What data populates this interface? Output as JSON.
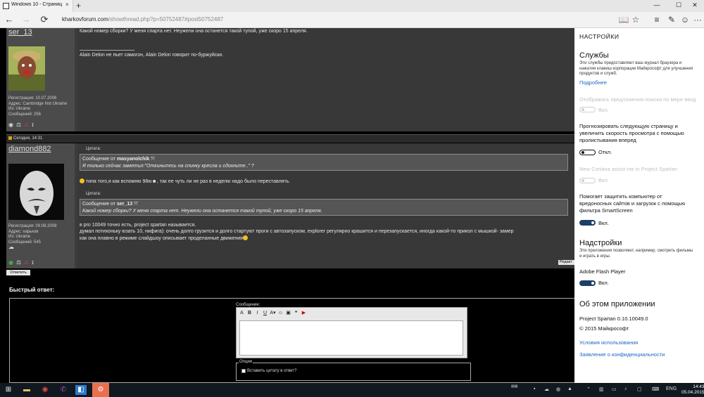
{
  "tabbar": {
    "tab_title": "Windows 10 - Страница...",
    "tab_close": "×",
    "new_tab": "+",
    "minimize": "—",
    "maximize": "☐",
    "close": "✕"
  },
  "navbar": {
    "back": "←",
    "forward": "→",
    "refresh": "⟳",
    "url_domain": "kharkovforum.com",
    "url_path": "/showthread.php?p=50752487#post50752487"
  },
  "tools": {
    "reading_view": "📖",
    "favorite": "☆",
    "hub": "≡",
    "notes": "✎",
    "feedback": "☺",
    "more": "···"
  },
  "posts": [
    {
      "username": "ser_13",
      "info": [
        "Регистрация: 10.07.2006",
        "Адрес: Cambridge Not Ukraine",
        "Из: Ukraine",
        "Сообщений: 256"
      ],
      "body": "Какой номер сборки? У меня спарта нет. Неужели она останется такой тупой, уже скоро 15 апреля.",
      "signature": "Alain Delon не пьет самогон, Alain Delon говорит по-буржуйски."
    },
    {
      "date": "Сегодня, 14:31",
      "username": "diamond882",
      "info": [
        "Регистрация: 09.08.2008",
        "Адрес: харьков",
        "Из: Ukraine",
        "Сообщений: 545"
      ],
      "quote_label": "Цитата:",
      "quote1_prefix": "Сообщение от",
      "quote1_author": "masyanolchik",
      "quote1_text": "Я только сейчас заметил:\"Откиньтесь на спинку кресла и сдохните..\" ?",
      "line1": "типа того,я как вспомню 98ю",
      "line1_tail": ", так ее чуть ли не раз в неделю надо было переставлять.",
      "quote2_prefix": "Сообщение от",
      "quote2_author": "ser_13",
      "quote2_text": "Какой номер сборки? У меня спарта нет. Неужели она останется такой тупой, уже скоро 15 апреля.",
      "line2": "в pro 10049 точно есть, project spartan называется.",
      "line3": "думал потихоньку юзать 10, нифига): очень долго грузится и долго стартуют проги с автозапуском, explorer регулярно крашится и перезапускается, иногда какой-то прикол с мышкой- замер",
      "line4": "как она плавно в режиме слайдшоу описывает проделанные движения"
    }
  ],
  "reply_button": "Ответить",
  "edit_button": "Редакт",
  "quick_reply": {
    "title": "Быстрый ответ:",
    "message_label": "Сообщение:",
    "options_legend": "Опции",
    "quote_checkbox": "Вставить цитату в ответ?"
  },
  "settings": {
    "header": "НАСТРОЙКИ",
    "services_title": "Службы",
    "services_desc": [
      "Эти службы предоставляют ваш журнал браузера и",
      "нажатия клавиш корпорации Майкрософт для улучшения",
      "продуктов и служб."
    ],
    "more_link": "Подробнее",
    "search_suggestions": "Отображать предложения поиска по мере ввод",
    "search_suggestions_state": "Вкл.",
    "prefetch": [
      "Прогнозировать следующую страницу и",
      "увеличить скорость просмотра с помощью",
      "пролистывания вперед"
    ],
    "prefetch_state": "Откл.",
    "cortana": "New Cortana assist me in Project Spartan",
    "cortana_state": "Вкл.",
    "smartscreen": [
      "Помогает защитить компьютер от",
      "вредоносных сайтов и загрузок с помощью",
      "фильтра SmartScreen"
    ],
    "smartscreen_state": "Вкл.",
    "addons_title": "Надстройки",
    "addons_desc": [
      "Эти приложения позволяют, например, смотреть фильмы",
      "и играть в игры."
    ],
    "flash": "Adobe Flash Player",
    "flash_state": "Вкл.",
    "about_title": "Об этом приложении",
    "version": "Project Spartan 0.10.10049.0",
    "copyright": "© 2015 Майкрософт",
    "terms_link": "Условия использования",
    "privacy_link": "Заявление о конфиденциальности"
  },
  "taskbar": {
    "time": "14:43",
    "date": "05.04.2015",
    "lang": "ENG"
  },
  "colors": {
    "accent": "#1a66c8",
    "toggle_on": "#1c3f66",
    "taskbar": "#101820"
  }
}
